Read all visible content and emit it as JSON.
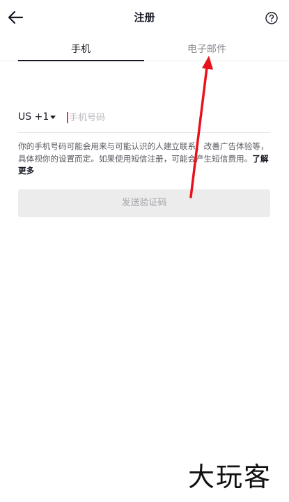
{
  "header": {
    "title": "注册",
    "back_icon": "arrow-left-icon",
    "help_icon": "question-circle-icon"
  },
  "tabs": [
    {
      "label": "手机",
      "active": true
    },
    {
      "label": "电子邮件",
      "active": false
    }
  ],
  "phone": {
    "country_code": "US +1",
    "placeholder": "手机号码",
    "value": ""
  },
  "notice": {
    "text": "你的手机号码可能会用来与可能认识的人建立联系、改善广告体验等，具体视你的设置而定。如果使用短信注册，可能会产生短信费用。",
    "link": "了解更多"
  },
  "send_button": {
    "label": "发送验证码"
  },
  "annotation": {
    "arrow_color": "#e8121d"
  },
  "watermark": "大玩客",
  "colors": {
    "accent_caret": "#fe2c55",
    "text_primary": "#161823",
    "text_secondary": "#8a8b91",
    "button_disabled_bg": "#ececed"
  }
}
